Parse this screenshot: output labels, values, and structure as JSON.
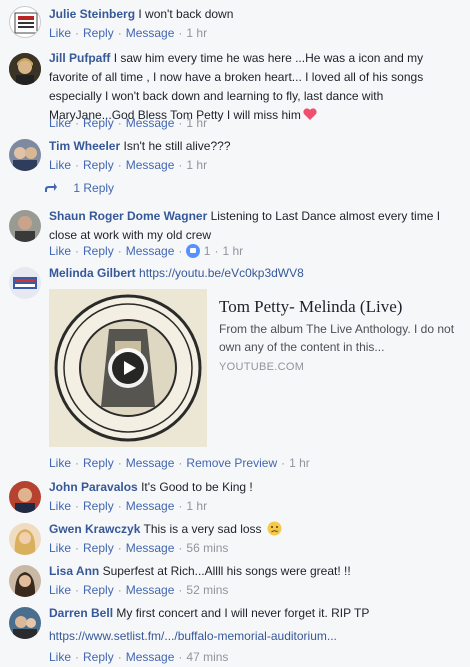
{
  "comments": [
    {
      "author": "Julie Steinberg",
      "text": "I won't back down",
      "actions": {
        "like": "Like",
        "reply": "Reply",
        "message": "Message",
        "time": "1 hr"
      }
    },
    {
      "author": "Jill Pufpaff",
      "text": "I saw him every time he was here ...He was a icon and my favorite of all time , I now have a broken heart... I loved all of his songs especially I won't back down and learning to fly, last dance with MaryJane...God Bless Tom Petty I will miss him",
      "actions": {
        "like": "Like",
        "reply": "Reply",
        "message": "Message",
        "time": "1 hr"
      }
    },
    {
      "author": "Tim Wheeler",
      "text": "Isn't he still alive???",
      "actions": {
        "like": "Like",
        "reply": "Reply",
        "message": "Message",
        "time": "1 hr"
      },
      "replies_label": "1 Reply"
    },
    {
      "author": "Shaun Roger Dome Wagner",
      "text": "Listening to Last Dance almost every time I close at work with my old crew",
      "actions": {
        "like": "Like",
        "reply": "Reply",
        "message": "Message",
        "reaction_count": "1",
        "time": "1 hr"
      }
    },
    {
      "author": "Melinda Gilbert",
      "link": "https://youtu.be/eVc0kp3dWV8",
      "preview": {
        "title": "Tom Petty- Melinda (Live)",
        "description": "From the album The Live Anthology. I do not own any of the content in this...",
        "source": "YOUTUBE.COM"
      },
      "actions": {
        "like": "Like",
        "reply": "Reply",
        "message": "Message",
        "remove": "Remove Preview",
        "time": "1 hr"
      }
    },
    {
      "author": "John Paravalos",
      "text": "It's Good to be King !",
      "actions": {
        "like": "Like",
        "reply": "Reply",
        "message": "Message",
        "time": "1 hr"
      }
    },
    {
      "author": "Gwen Krawczyk",
      "text": "This is a very sad loss",
      "actions": {
        "like": "Like",
        "reply": "Reply",
        "message": "Message",
        "time": "56 mins"
      }
    },
    {
      "author": "Lisa Ann",
      "text": "Superfest at Rich...Allll his songs were great! !!",
      "actions": {
        "like": "Like",
        "reply": "Reply",
        "message": "Message",
        "time": "52 mins"
      }
    },
    {
      "author": "Darren Bell",
      "text": "My first concert and I will never forget it. RIP TP",
      "url": "https://www.setlist.fm/.../buffalo-memorial-auditorium...",
      "actions": {
        "like": "Like",
        "reply": "Reply",
        "message": "Message",
        "time": "47 mins"
      }
    }
  ],
  "separator": "·",
  "colors": {
    "link": "#365899",
    "action": "#4267b2",
    "meta": "#90949c",
    "background": "#f6f7f9"
  }
}
